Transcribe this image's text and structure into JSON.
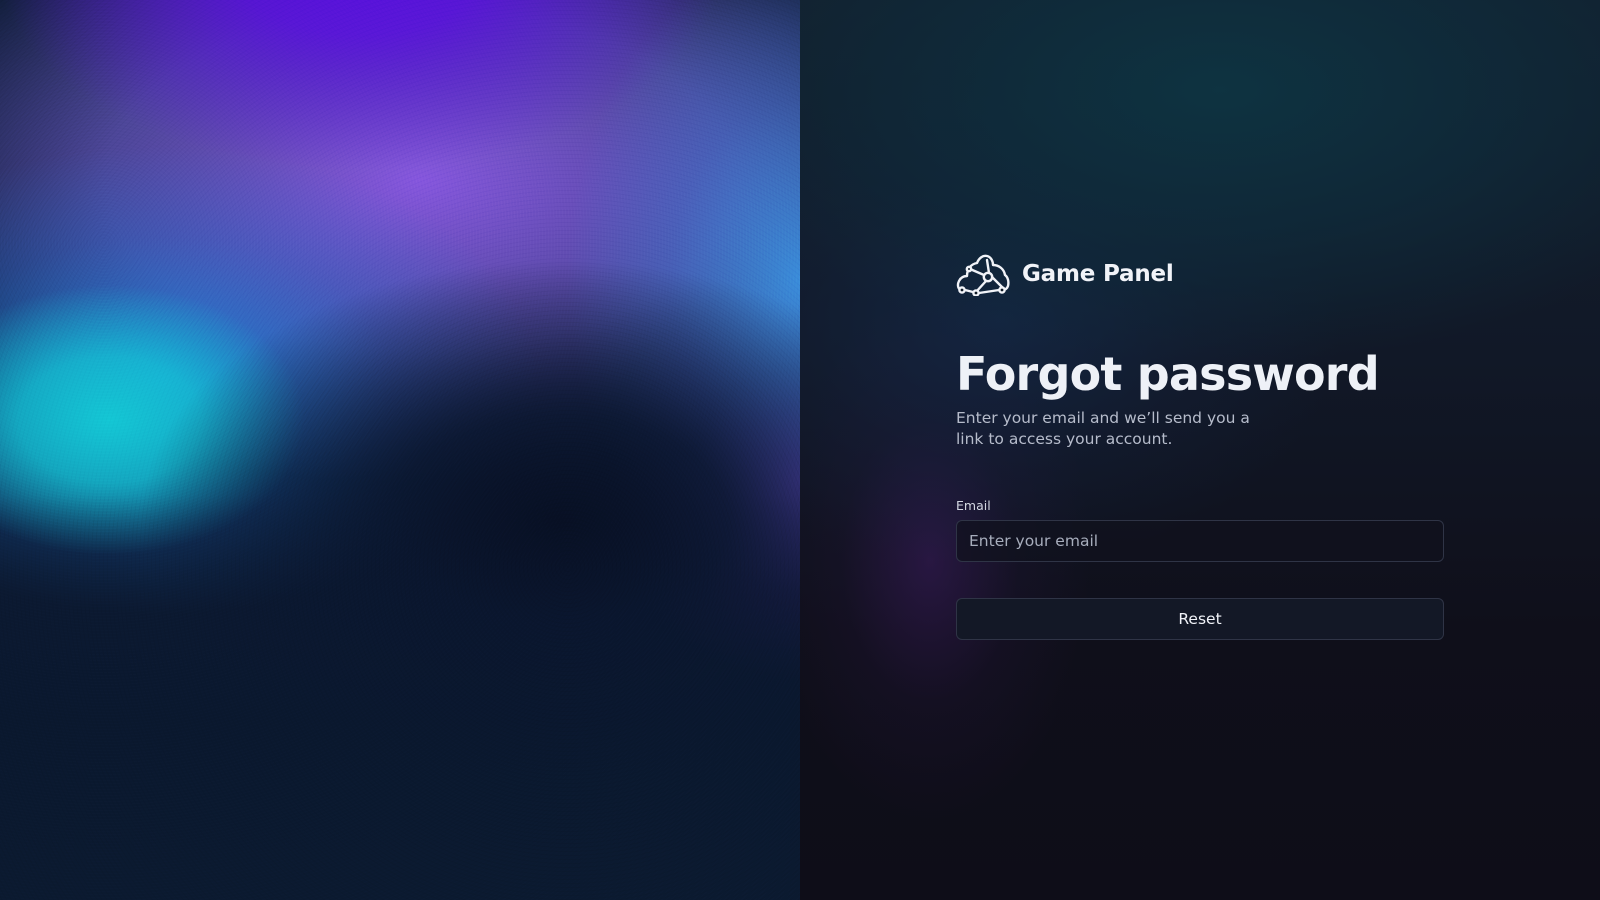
{
  "brand": {
    "name": "Game Panel",
    "logo_icon": "game-panel-logo-icon"
  },
  "form": {
    "title": "Forgot password",
    "subtitle": "Enter your email and we’ll send you a link to access your account.",
    "email_label": "Email",
    "email_placeholder": "Enter your email",
    "email_value": "",
    "submit_label": "Reset"
  },
  "colors": {
    "background": "#0f0f1a",
    "text_primary": "#eef1f7",
    "text_secondary": "#b6bccb",
    "input_border": "#2f3446",
    "button_background": "#131826",
    "gradient_violet": "#5a0fe0",
    "gradient_cyan": "#14c6d4"
  }
}
